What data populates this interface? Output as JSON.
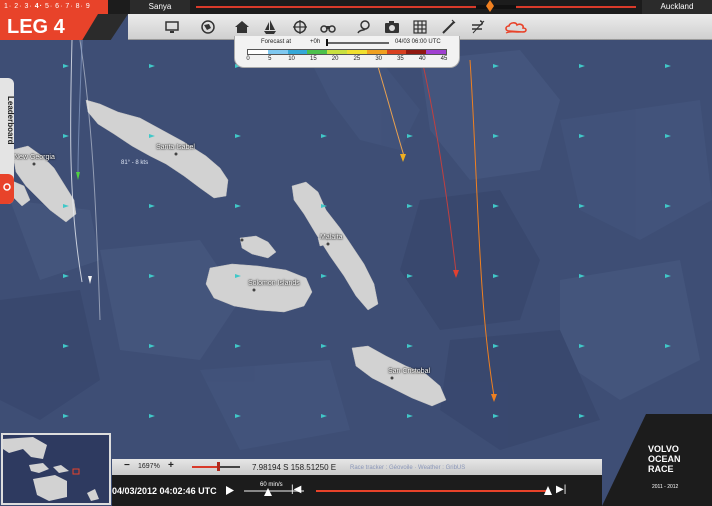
{
  "top": {
    "legs": [
      "1",
      "2",
      "3",
      "4",
      "5",
      "6",
      "7",
      "8",
      "9"
    ],
    "active_leg": "4",
    "from_city": "Sanya",
    "to_city": "Auckland"
  },
  "leg_title": "LEG 4",
  "forecast": {
    "label": "Forecast at",
    "offset": "+0h",
    "date": "04/03 06:00 UTC",
    "scale_labels": [
      "0",
      "5",
      "10",
      "15",
      "20",
      "25",
      "30",
      "35",
      "40",
      "45"
    ],
    "scale_colors": [
      "#ffffff",
      "#7fc8f0",
      "#35a8d8",
      "#4cc04c",
      "#c8e040",
      "#f0e030",
      "#f0a020",
      "#d84020",
      "#901810",
      "#a040d0"
    ]
  },
  "leaderboard": {
    "label": "Leaderboard"
  },
  "map_labels": {
    "new_georgia": "New Georgia",
    "santa_isabel": "Santa Isabel",
    "malaita": "Malaita",
    "solomon_islands": "Solomon Islands",
    "san_cristobal": "San Cristobal"
  },
  "boat_speed": "81° - 8 kts",
  "status": {
    "zoom": "1697%",
    "coords": "7.98194 S 158.51250 E",
    "credits": "Race tracker : Géovoile · Weather : GribUS"
  },
  "timeline": {
    "datetime": "04/03/2012 04:02:46 UTC",
    "speed": "60 min/s"
  },
  "logo": {
    "line1": "VOLVO",
    "line2": "OCEAN",
    "line3": "RACE",
    "years": "2011 - 2012"
  },
  "colors": {
    "accent": "#e8432a",
    "sea": "#3d4d73",
    "land": "#d2d2d2"
  },
  "icons": [
    "monitor-icon",
    "globe-icon",
    "home-icon",
    "sailboat-icon",
    "target-icon",
    "binoculars-icon",
    "route-icon",
    "camera-icon",
    "grid-icon",
    "ruler-icon",
    "wind-toggle-icon",
    "weather-cloud-icon"
  ]
}
